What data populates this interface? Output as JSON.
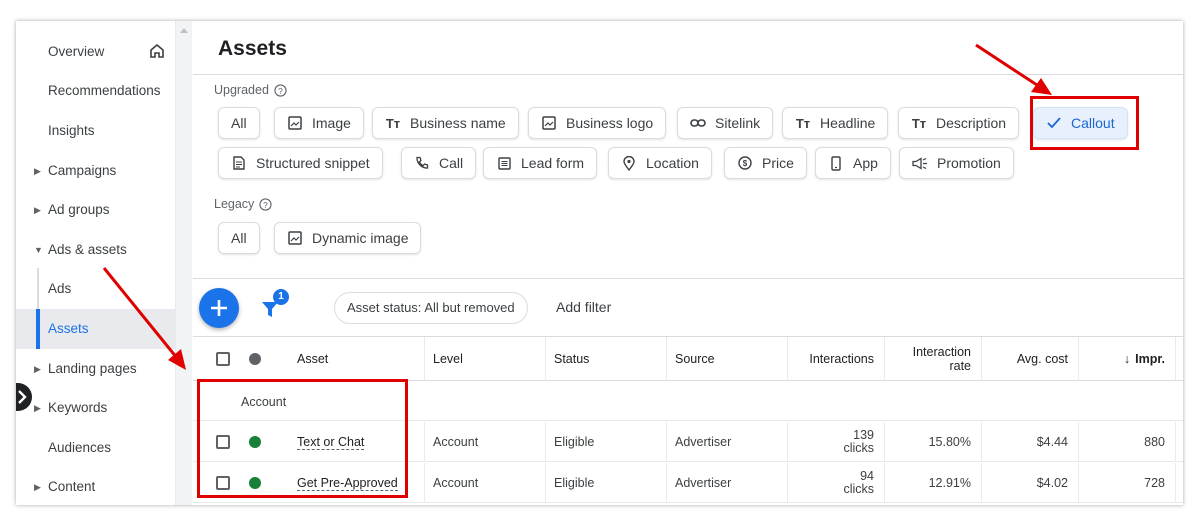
{
  "sidebar": {
    "items": [
      {
        "label": "Overview"
      },
      {
        "label": "Recommendations"
      },
      {
        "label": "Insights"
      },
      {
        "label": "Campaigns"
      },
      {
        "label": "Ad groups"
      },
      {
        "label": "Ads & assets"
      },
      {
        "label": "Ads"
      },
      {
        "label": "Assets"
      },
      {
        "label": "Landing pages"
      },
      {
        "label": "Keywords"
      },
      {
        "label": "Audiences"
      },
      {
        "label": "Content"
      }
    ]
  },
  "header": {
    "title": "Assets"
  },
  "upgraded": {
    "label": "Upgraded",
    "chips": [
      {
        "label": "All",
        "icon": "none"
      },
      {
        "label": "Image",
        "icon": "image-icon"
      },
      {
        "label": "Business name",
        "icon": "text-icon"
      },
      {
        "label": "Business logo",
        "icon": "image-icon"
      },
      {
        "label": "Sitelink",
        "icon": "link-icon"
      },
      {
        "label": "Headline",
        "icon": "text-icon"
      },
      {
        "label": "Description",
        "icon": "text-icon"
      },
      {
        "label": "Callout",
        "icon": "check-icon",
        "selected": true
      },
      {
        "label": "Structured snippet",
        "icon": "document-icon"
      },
      {
        "label": "Call",
        "icon": "phone-icon"
      },
      {
        "label": "Lead form",
        "icon": "form-icon"
      },
      {
        "label": "Location",
        "icon": "location-pin-icon"
      },
      {
        "label": "Price",
        "icon": "price-icon"
      },
      {
        "label": "App",
        "icon": "phone-device-icon"
      },
      {
        "label": "Promotion",
        "icon": "megaphone-icon"
      }
    ]
  },
  "legacy": {
    "label": "Legacy",
    "chips": [
      {
        "label": "All",
        "icon": "none"
      },
      {
        "label": "Dynamic image",
        "icon": "image-icon"
      }
    ]
  },
  "toolbar": {
    "filter_count": "1",
    "status_filter": "Asset status: All but removed",
    "add_filter": "Add filter"
  },
  "table": {
    "columns": [
      "Asset",
      "Level",
      "Status",
      "Source",
      "Interactions",
      "Interaction rate",
      "Avg. cost",
      "Impr."
    ],
    "group_label": "Account",
    "rows": [
      {
        "asset": "Text or Chat",
        "level": "Account",
        "status": "Eligible",
        "source": "Advertiser",
        "interactions": "139",
        "interactions_unit": "clicks",
        "rate": "15.80%",
        "avg_cost": "$4.44",
        "impr": "880"
      },
      {
        "asset": "Get Pre-Approved",
        "level": "Account",
        "status": "Eligible",
        "source": "Advertiser",
        "interactions": "94",
        "interactions_unit": "clicks",
        "rate": "12.91%",
        "avg_cost": "$4.02",
        "impr": "728"
      }
    ]
  },
  "colors": {
    "accent": "#1a73e8",
    "eligible": "#188038",
    "annotation": "#e00000"
  }
}
